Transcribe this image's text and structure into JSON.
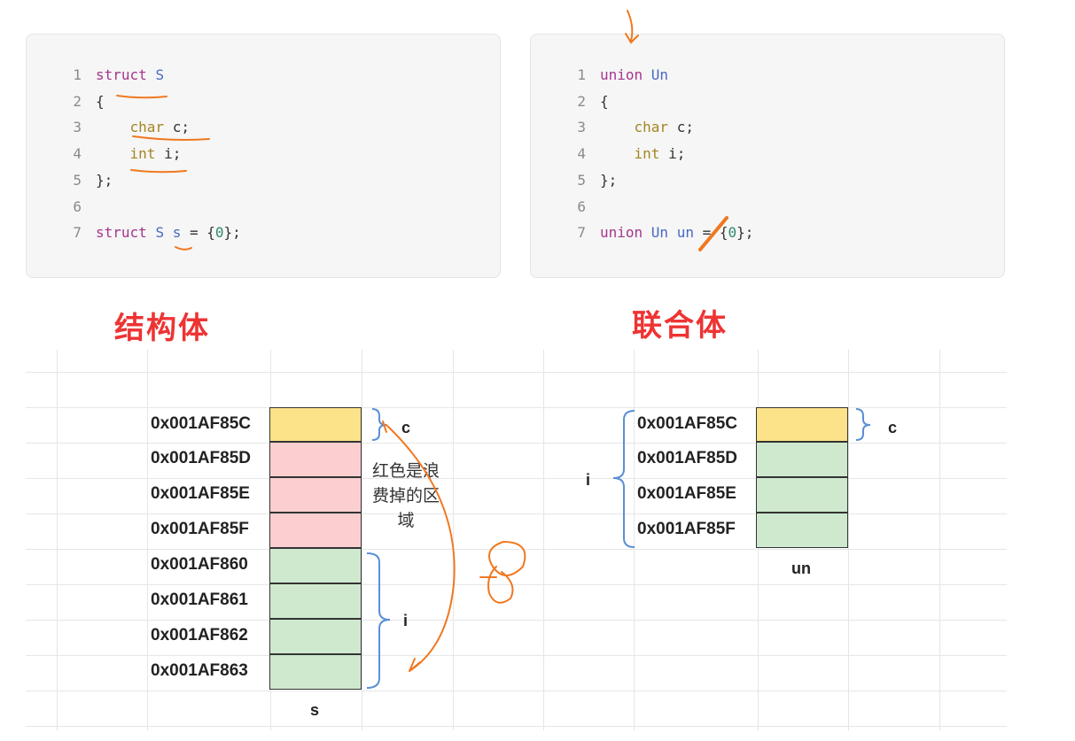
{
  "struct_code": {
    "lines": [
      {
        "n": "1",
        "parts": [
          {
            "t": "struct ",
            "c": "kw"
          },
          {
            "t": "S",
            "c": "id"
          }
        ]
      },
      {
        "n": "2",
        "parts": [
          {
            "t": "{",
            "c": "pl"
          }
        ]
      },
      {
        "n": "3",
        "parts": [
          {
            "t": "    ",
            "c": "pl"
          },
          {
            "t": "char",
            "c": "ty"
          },
          {
            "t": " c;",
            "c": "pl"
          }
        ]
      },
      {
        "n": "4",
        "parts": [
          {
            "t": "    ",
            "c": "pl"
          },
          {
            "t": "int",
            "c": "ty"
          },
          {
            "t": " i;",
            "c": "pl"
          }
        ]
      },
      {
        "n": "5",
        "parts": [
          {
            "t": "};",
            "c": "pl"
          }
        ]
      },
      {
        "n": "6",
        "parts": []
      },
      {
        "n": "7",
        "parts": [
          {
            "t": "struct ",
            "c": "kw"
          },
          {
            "t": "S s",
            "c": "id"
          },
          {
            "t": " = {",
            "c": "pl"
          },
          {
            "t": "0",
            "c": "nm"
          },
          {
            "t": "};",
            "c": "pl"
          }
        ]
      }
    ]
  },
  "union_code": {
    "lines": [
      {
        "n": "1",
        "parts": [
          {
            "t": "union ",
            "c": "kw"
          },
          {
            "t": "Un",
            "c": "id"
          }
        ]
      },
      {
        "n": "2",
        "parts": [
          {
            "t": "{",
            "c": "pl"
          }
        ]
      },
      {
        "n": "3",
        "parts": [
          {
            "t": "    ",
            "c": "pl"
          },
          {
            "t": "char",
            "c": "ty"
          },
          {
            "t": " c;",
            "c": "pl"
          }
        ]
      },
      {
        "n": "4",
        "parts": [
          {
            "t": "    ",
            "c": "pl"
          },
          {
            "t": "int",
            "c": "ty"
          },
          {
            "t": " i;",
            "c": "pl"
          }
        ]
      },
      {
        "n": "5",
        "parts": [
          {
            "t": "};",
            "c": "pl"
          }
        ]
      },
      {
        "n": "6",
        "parts": []
      },
      {
        "n": "7",
        "parts": [
          {
            "t": "union ",
            "c": "kw"
          },
          {
            "t": "Un un",
            "c": "id"
          },
          {
            "t": " = {",
            "c": "pl"
          },
          {
            "t": "0",
            "c": "nm"
          },
          {
            "t": "};",
            "c": "pl"
          }
        ]
      }
    ]
  },
  "titles": {
    "struct": "结构体",
    "union": "联合体"
  },
  "struct_memory": {
    "addresses": [
      "0x001AF85C",
      "0x001AF85D",
      "0x001AF85E",
      "0x001AF85F",
      "0x001AF860",
      "0x001AF861",
      "0x001AF862",
      "0x001AF863"
    ],
    "cell_colors": [
      "yellow",
      "red",
      "red",
      "red",
      "green",
      "green",
      "green",
      "green"
    ],
    "member_c": "c",
    "member_i": "i",
    "var_name": "s",
    "waste_note": [
      "红色是浪",
      "费掉的区",
      "域"
    ]
  },
  "union_memory": {
    "addresses": [
      "0x001AF85C",
      "0x001AF85D",
      "0x001AF85E",
      "0x001AF85F"
    ],
    "cell_colors": [
      "yellow",
      "green",
      "green",
      "green"
    ],
    "member_c": "c",
    "member_i": "i",
    "var_name": "un"
  },
  "colors": {
    "yellow": "#fce38a",
    "red": "#fbcfd0",
    "green": "#cfe9cf",
    "title_red": "#ee3333",
    "annotation_orange": "#f07820",
    "bracket_blue": "#5b8fd6"
  }
}
